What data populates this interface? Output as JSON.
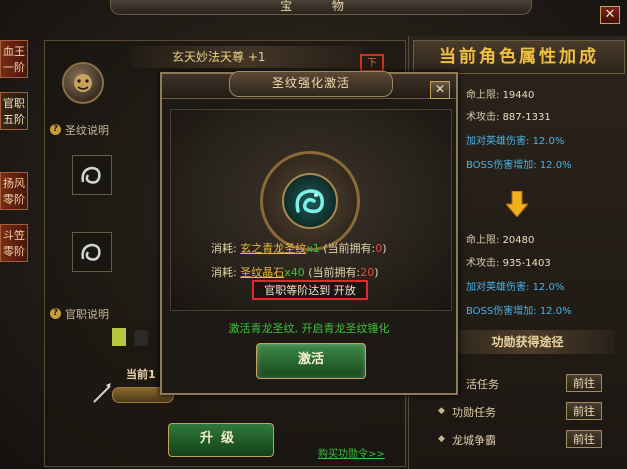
{
  "window": {
    "title": "宝 物",
    "close": "✕"
  },
  "left_tabs": [
    {
      "label": "血王\n一阶"
    },
    {
      "label": "官职\n五阶"
    },
    {
      "label": "扬风\n零阶"
    },
    {
      "label": "斗笠\n零阶"
    }
  ],
  "left": {
    "item_name": "玄天妙法天尊 +1",
    "badge": "下",
    "rune_help": "圣纹说明",
    "rank_help": "官职说明",
    "current_label": "当前1",
    "upgrade_label": "升级",
    "buy_link": "购买功勋令>>"
  },
  "right": {
    "title": "当前角色属性加成",
    "before": [
      {
        "label": "命上限:",
        "value": "19440"
      },
      {
        "label": "术攻击:",
        "value": "887-1331"
      },
      {
        "label": "加对英雄伤害:",
        "value": "12.0%"
      },
      {
        "label": "BOSS伤害增加:",
        "value": "12.0%"
      }
    ],
    "after": [
      {
        "label": "命上限:",
        "value": "20480"
      },
      {
        "label": "术攻击:",
        "value": "935-1403"
      },
      {
        "label": "加对英雄伤害:",
        "value": "12.0%"
      },
      {
        "label": "BOSS伤害增加:",
        "value": "12.0%"
      }
    ],
    "routes_title": "功勋获得途径",
    "routes": [
      {
        "label": "活任务",
        "button": "前往"
      },
      {
        "label": "功勋任务",
        "button": "前往"
      },
      {
        "label": "龙城争霸",
        "button": "前往"
      }
    ]
  },
  "dialog": {
    "title": "圣纹强化激活",
    "close": "✕",
    "costs": [
      {
        "prefix": "消耗:",
        "item": "玄之青龙圣纹",
        "count": "x1",
        "own_prefix": "(当前拥有:",
        "own": "0",
        "own_suffix": ")"
      },
      {
        "prefix": "消耗:",
        "item": "圣纹晶石",
        "count": "x40",
        "own_prefix": "(当前拥有:",
        "own": "20",
        "own_suffix": ")"
      }
    ],
    "condition": "官职等阶达到 开放",
    "description": "激活青龙圣纹, 开启青龙圣纹锤化",
    "activate_label": "激活"
  },
  "colors": {
    "accent_gold": "#f0c040",
    "highlight_green": "#3ec03a",
    "warn_red": "#e02a2a",
    "stat_blue": "#46b4e8"
  },
  "icons": [
    "close-icon",
    "lion-emblem-icon",
    "question-icon",
    "rune-slot-icon",
    "down-arrow-icon",
    "dragon-emblem-icon",
    "bullet-icon"
  ]
}
